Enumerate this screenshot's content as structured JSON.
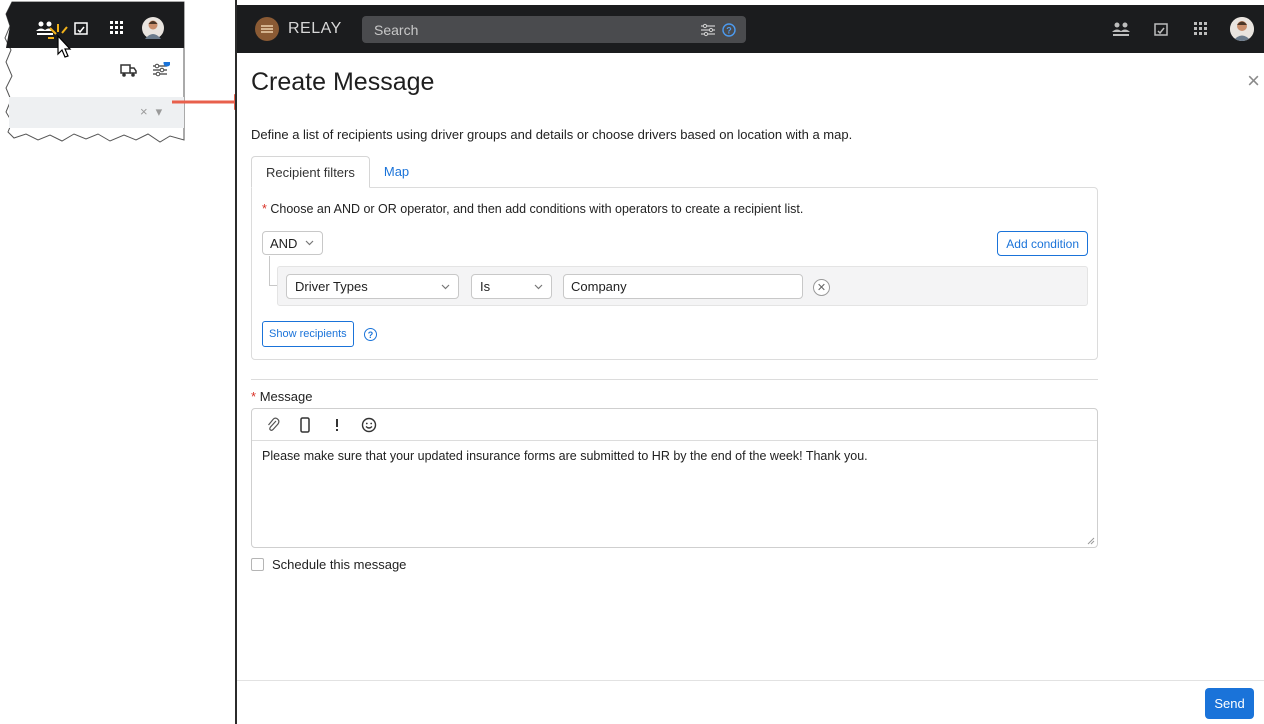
{
  "app": {
    "brand": "RELAY",
    "search_placeholder": "Search"
  },
  "dialog": {
    "title": "Create Message",
    "description": "Define a list of recipients using driver groups and details or choose drivers based on location with a map.",
    "tabs": [
      {
        "label": "Recipient filters",
        "active": true
      },
      {
        "label": "Map",
        "active": false
      }
    ],
    "filters": {
      "required_mark": "*",
      "note": "Choose an AND or OR operator, and then add conditions with operators to create a recipient list.",
      "operator": "AND",
      "add_condition_label": "Add condition",
      "condition": {
        "field": "Driver Types",
        "operator": "Is",
        "value": "Company"
      },
      "show_recipients_label": "Show recipients"
    },
    "message": {
      "required_mark": "*",
      "label": "Message",
      "text": "Please make sure that your updated insurance forms are submitted to HR by the end of the week! Thank you."
    },
    "schedule_label": "Schedule this message",
    "send_label": "Send"
  },
  "inset": {
    "clear_symbol": "×"
  },
  "colors": {
    "topbar": "#1b1c1e",
    "accent": "#1a73d9",
    "required": "#d93025",
    "arrow": "#e8604c"
  }
}
